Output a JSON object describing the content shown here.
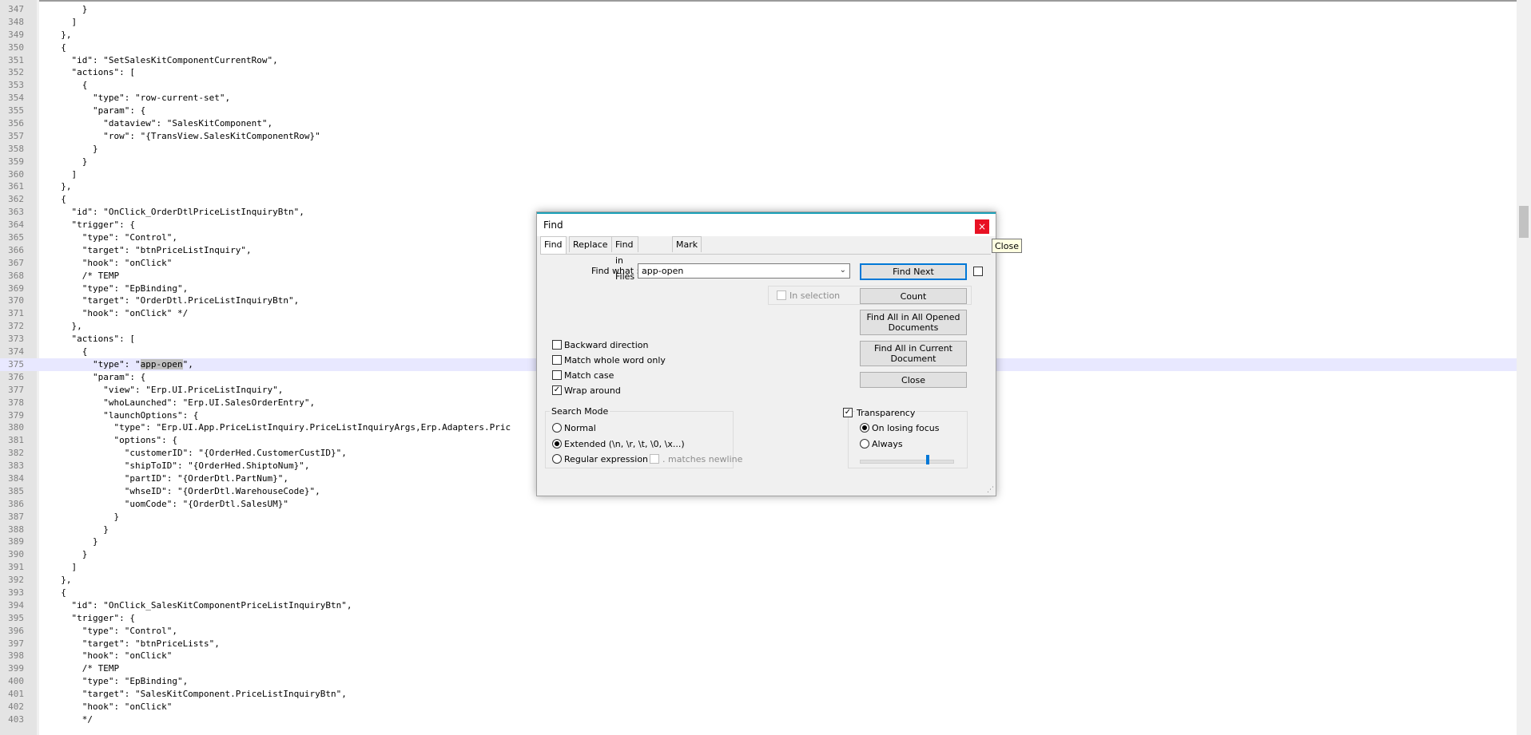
{
  "editor": {
    "lines": [
      {
        "n": "347",
        "text": "      }",
        "current": false
      },
      {
        "n": "348",
        "text": "    ]",
        "current": false
      },
      {
        "n": "349",
        "text": "  },",
        "current": false
      },
      {
        "n": "350",
        "text": "  {",
        "current": false
      },
      {
        "n": "351",
        "text": "    \"id\": \"SetSalesKitComponentCurrentRow\",",
        "current": false
      },
      {
        "n": "352",
        "text": "    \"actions\": [",
        "current": false
      },
      {
        "n": "353",
        "text": "      {",
        "current": false
      },
      {
        "n": "354",
        "text": "        \"type\": \"row-current-set\",",
        "current": false
      },
      {
        "n": "355",
        "text": "        \"param\": {",
        "current": false
      },
      {
        "n": "356",
        "text": "          \"dataview\": \"SalesKitComponent\",",
        "current": false
      },
      {
        "n": "357",
        "text": "          \"row\": \"{TransView.SalesKitComponentRow}\"",
        "current": false
      },
      {
        "n": "358",
        "text": "        }",
        "current": false
      },
      {
        "n": "359",
        "text": "      }",
        "current": false
      },
      {
        "n": "360",
        "text": "    ]",
        "current": false
      },
      {
        "n": "361",
        "text": "  },",
        "current": false
      },
      {
        "n": "362",
        "text": "  {",
        "current": false
      },
      {
        "n": "363",
        "text": "    \"id\": \"OnClick_OrderDtlPriceListInquiryBtn\",",
        "current": false
      },
      {
        "n": "364",
        "text": "    \"trigger\": {",
        "current": false
      },
      {
        "n": "365",
        "text": "      \"type\": \"Control\",",
        "current": false
      },
      {
        "n": "366",
        "text": "      \"target\": \"btnPriceListInquiry\",",
        "current": false
      },
      {
        "n": "367",
        "text": "      \"hook\": \"onClick\"",
        "current": false
      },
      {
        "n": "368",
        "text": "      /* TEMP",
        "current": false
      },
      {
        "n": "369",
        "text": "      \"type\": \"EpBinding\",",
        "current": false
      },
      {
        "n": "370",
        "text": "      \"target\": \"OrderDtl.PriceListInquiryBtn\",",
        "current": false
      },
      {
        "n": "371",
        "text": "      \"hook\": \"onClick\" */",
        "current": false
      },
      {
        "n": "372",
        "text": "    },",
        "current": false
      },
      {
        "n": "373",
        "text": "    \"actions\": [",
        "current": false
      },
      {
        "n": "374",
        "text": "      {",
        "current": false
      },
      {
        "n": "375",
        "text": "        \"type\": \"app-open\",",
        "current": true
      },
      {
        "n": "376",
        "text": "        \"param\": {",
        "current": false
      },
      {
        "n": "377",
        "text": "          \"view\": \"Erp.UI.PriceListInquiry\",",
        "current": false
      },
      {
        "n": "378",
        "text": "          \"whoLaunched\": \"Erp.UI.SalesOrderEntry\",",
        "current": false
      },
      {
        "n": "379",
        "text": "          \"launchOptions\": {",
        "current": false
      },
      {
        "n": "380",
        "text": "            \"type\": \"Erp.UI.App.PriceListInquiry.PriceListInquiryArgs,Erp.Adapters.Pric",
        "current": false
      },
      {
        "n": "381",
        "text": "            \"options\": {",
        "current": false
      },
      {
        "n": "382",
        "text": "              \"customerID\": \"{OrderHed.CustomerCustID}\",",
        "current": false
      },
      {
        "n": "383",
        "text": "              \"shipToID\": \"{OrderHed.ShiptoNum}\",",
        "current": false
      },
      {
        "n": "384",
        "text": "              \"partID\": \"{OrderDtl.PartNum}\",",
        "current": false
      },
      {
        "n": "385",
        "text": "              \"whseID\": \"{OrderDtl.WarehouseCode}\",",
        "current": false
      },
      {
        "n": "386",
        "text": "              \"uomCode\": \"{OrderDtl.SalesUM}\"",
        "current": false
      },
      {
        "n": "387",
        "text": "            }",
        "current": false
      },
      {
        "n": "388",
        "text": "          }",
        "current": false
      },
      {
        "n": "389",
        "text": "        }",
        "current": false
      },
      {
        "n": "390",
        "text": "      }",
        "current": false
      },
      {
        "n": "391",
        "text": "    ]",
        "current": false
      },
      {
        "n": "392",
        "text": "  },",
        "current": false
      },
      {
        "n": "393",
        "text": "  {",
        "current": false
      },
      {
        "n": "394",
        "text": "    \"id\": \"OnClick_SalesKitComponentPriceListInquiryBtn\",",
        "current": false
      },
      {
        "n": "395",
        "text": "    \"trigger\": {",
        "current": false
      },
      {
        "n": "396",
        "text": "      \"type\": \"Control\",",
        "current": false
      },
      {
        "n": "397",
        "text": "      \"target\": \"btnPriceLists\",",
        "current": false
      },
      {
        "n": "398",
        "text": "      \"hook\": \"onClick\"",
        "current": false
      },
      {
        "n": "399",
        "text": "      /* TEMP",
        "current": false
      },
      {
        "n": "400",
        "text": "      \"type\": \"EpBinding\",",
        "current": false
      },
      {
        "n": "401",
        "text": "      \"target\": \"SalesKitComponent.PriceListInquiryBtn\",",
        "current": false
      },
      {
        "n": "402",
        "text": "      \"hook\": \"onClick\"",
        "current": false
      },
      {
        "n": "403",
        "text": "      */",
        "current": false
      }
    ],
    "highlight_term": "app-open"
  },
  "find_dialog": {
    "title": "Find",
    "close_glyph": "×",
    "tabs": [
      "Find",
      "Replace",
      "Find in Files",
      "Mark"
    ],
    "active_tab": "Find",
    "find_what_label": "Find what :",
    "find_what_value": "app-open",
    "in_selection_label": "In selection",
    "buttons": {
      "find_next": "Find Next",
      "count": "Count",
      "find_all_opened": "Find All in All Opened Documents",
      "find_all_current": "Find All in Current Document",
      "close": "Close"
    },
    "options": [
      {
        "label": "Backward direction",
        "checked": false
      },
      {
        "label": "Match whole word only",
        "checked": false
      },
      {
        "label": "Match case",
        "checked": false
      },
      {
        "label": "Wrap around",
        "checked": true
      }
    ],
    "search_mode": {
      "title": "Search Mode",
      "normal": "Normal",
      "extended": "Extended (\\n, \\r, \\t, \\0, \\x...)",
      "regex": "Regular expression",
      "matches_newline": ". matches newline",
      "selected": "extended"
    },
    "transparency": {
      "label": "Transparency",
      "checked": true,
      "on_losing_focus": "On losing focus",
      "always": "Always",
      "selected": "on_losing_focus",
      "level": 0.7
    }
  },
  "tooltip": {
    "text": "Close"
  },
  "colors": {
    "accent": "#0078d7",
    "close_red": "#e81123",
    "current_line": "#e8e8ff"
  }
}
